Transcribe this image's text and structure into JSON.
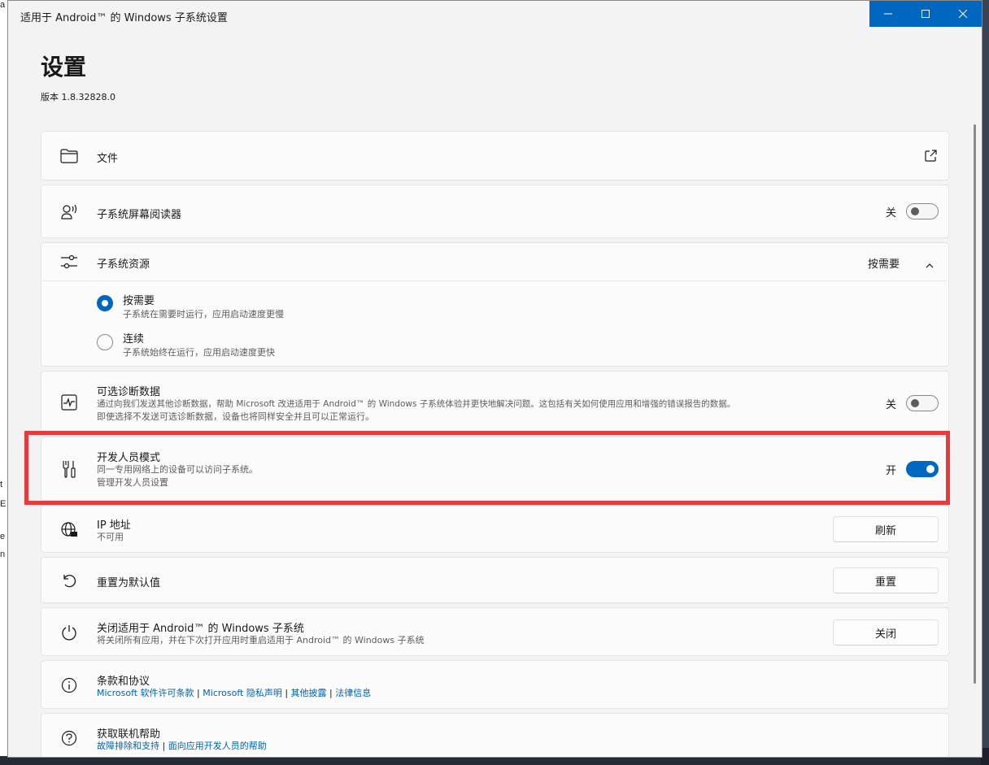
{
  "background": {
    "left_fragments": [
      "e",
      "a",
      "t",
      "E",
      "e",
      "n"
    ]
  },
  "window": {
    "title": "适用于 Android™ 的 Windows 子系统设置",
    "caption_buttons": {
      "minimize_icon": "minimize-icon",
      "maximize_icon": "maximize-icon",
      "close_icon": "close-icon"
    }
  },
  "page": {
    "title": "设置",
    "version": "版本 1.8.32828.0"
  },
  "files": {
    "label": "文件",
    "icon": "folder-icon",
    "action_icon": "open-external-icon"
  },
  "screen_reader": {
    "label": "子系统屏幕阅读器",
    "icon": "screen-reader-icon",
    "toggle_text": "关",
    "toggle_on": false
  },
  "resources": {
    "label": "子系统资源",
    "icon": "sliders-icon",
    "selected_value": "按需要",
    "expand_icon": "chevron-up-icon",
    "options": [
      {
        "label": "按需要",
        "desc": "子系统在需要时运行，应用启动速度更慢",
        "checked": true
      },
      {
        "label": "连续",
        "desc": "子系统始终在运行，应用启动速度更快",
        "checked": false
      }
    ]
  },
  "diagnostics": {
    "label": "可选诊断数据",
    "icon": "activity-icon",
    "desc_line1": "通过向我们发送其他诊断数据，帮助 Microsoft 改进适用于 Android™ 的 Windows 子系统体验并更快地解决问题。这包括有关如何使用应用和增强的错误报告的数据。",
    "desc_line2": "即使选择不发送可选诊断数据，设备也将同样安全并且可以正常运行。",
    "toggle_text": "关",
    "toggle_on": false
  },
  "developer": {
    "label": "开发人员模式",
    "icon": "tools-icon",
    "desc": "同一专用网络上的设备可以访问子系统。",
    "link": "管理开发人员设置",
    "toggle_text": "开",
    "toggle_on": true
  },
  "ip": {
    "label": "IP 地址",
    "icon": "globe-network-icon",
    "desc": "不可用",
    "button": "刷新"
  },
  "reset": {
    "label": "重置为默认值",
    "icon": "undo-icon",
    "button": "重置"
  },
  "shutdown": {
    "label": "关闭适用于 Android™ 的 Windows 子系统",
    "icon": "power-icon",
    "desc": "将关闭所有应用，并在下次打开应用时重启适用于 Android™ 的 Windows 子系统",
    "button": "关闭"
  },
  "terms": {
    "label": "条款和协议",
    "icon": "info-icon",
    "links": [
      "Microsoft 软件许可条款",
      "Microsoft 隐私声明",
      "其他披露",
      "法律信息"
    ],
    "separator": " | "
  },
  "help": {
    "label": "获取联机帮助",
    "icon": "question-icon",
    "links": [
      "故障排除和支持",
      "面向应用开发人员的帮助"
    ],
    "separator": " | "
  },
  "colors": {
    "accent": "#0067c0",
    "highlight": "#e8393b",
    "link": "#0063b1"
  }
}
